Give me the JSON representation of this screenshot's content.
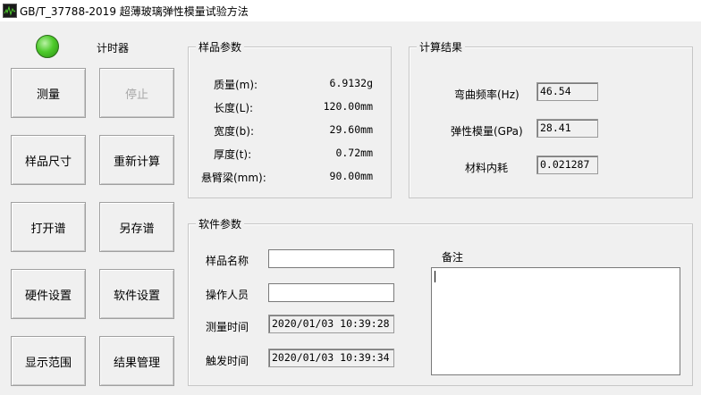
{
  "window": {
    "title": "GB/T_37788-2019 超薄玻璃弹性模量试验方法"
  },
  "timer": {
    "label": "计时器",
    "led_color": "#4ecb2c"
  },
  "buttons": {
    "measure": "测量",
    "stop": "停止",
    "sample_size": "样品尺寸",
    "recalculate": "重新计算",
    "open_spectrum": "打开谱",
    "save_spectrum_as": "另存谱",
    "hardware_settings": "硬件设置",
    "software_settings": "软件设置",
    "display_range": "显示范围",
    "result_management": "结果管理"
  },
  "sample_params": {
    "title": "样品参数",
    "rows": [
      {
        "label": "质量(m):",
        "value": "6.9132g"
      },
      {
        "label": "长度(L):",
        "value": "120.00mm"
      },
      {
        "label": "宽度(b):",
        "value": "29.60mm"
      },
      {
        "label": "厚度(t):",
        "value": "0.72mm"
      },
      {
        "label": "悬臂梁(mm):",
        "value": "90.00mm"
      }
    ]
  },
  "results": {
    "title": "计算结果",
    "rows": [
      {
        "label": "弯曲频率(Hz)",
        "value": "46.54"
      },
      {
        "label": "弹性模量(GPa)",
        "value": "28.41"
      },
      {
        "label": "材料内耗",
        "value": "0.021287"
      }
    ]
  },
  "software_params": {
    "title": "软件参数",
    "sample_name": {
      "label": "样品名称",
      "value": ""
    },
    "operator": {
      "label": "操作人员",
      "value": ""
    },
    "measure_time": {
      "label": "测量时间",
      "value": "2020/01/03 10:39:28"
    },
    "trigger_time": {
      "label": "触发时间",
      "value": "2020/01/03 10:39:34"
    },
    "notes": {
      "label": "备注",
      "value": ""
    }
  }
}
